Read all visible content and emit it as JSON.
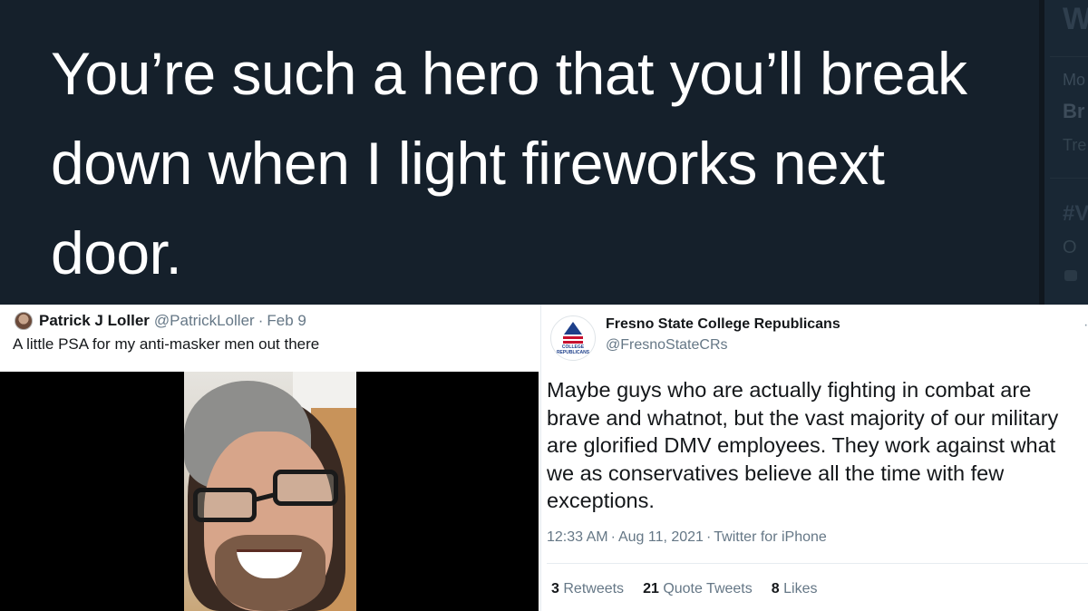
{
  "top_tweet": {
    "lines": [
      "You’re such a hero that you’ll break",
      "down when I light fireworks next",
      "door."
    ],
    "background_color": "#15202b"
  },
  "side_column": {
    "fragments": [
      "W",
      "Mo",
      "Br",
      "Tre",
      "#V",
      "O"
    ]
  },
  "left_tweet": {
    "author_name": "Patrick J Loller",
    "handle": "@PatrickLoller",
    "separator": "·",
    "date": "Feb 9",
    "text": "A little PSA for my anti-masker men out there",
    "avatar_icon": "profile-photo"
  },
  "right_tweet": {
    "author_name": "Fresno State College Republicans",
    "handle": "@FresnoStateCRs",
    "avatar_label": "COLLEGE REPUBLICANS",
    "more_icon": "·",
    "text_lines": [
      "Maybe guys who are actually fighting in combat are",
      "brave and whatnot, but the vast majority of our military",
      "are glorified DMV employees. They work against what",
      "we as conservatives believe all the time with few",
      "exceptions."
    ],
    "time": "12:33 AM",
    "date": "Aug 11, 2021",
    "source": "Twitter for iPhone",
    "separator": "·",
    "stats": {
      "retweets_count": "3",
      "retweets_label": "Retweets",
      "quotes_count": "21",
      "quotes_label": "Quote Tweets",
      "likes_count": "8",
      "likes_label": "Likes"
    },
    "accent_colors": {
      "navy": "#1d3f8a",
      "red": "#c8102e"
    }
  }
}
